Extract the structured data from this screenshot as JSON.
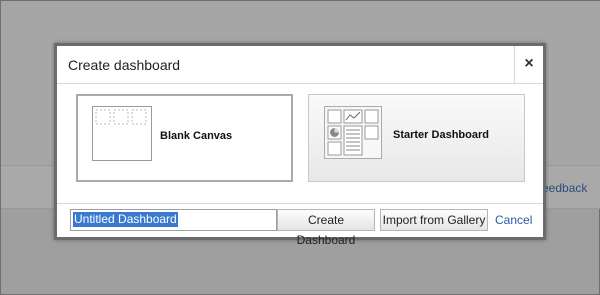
{
  "background": {
    "feedback_label": "eedback"
  },
  "dialog": {
    "title": "Create dashboard",
    "close_label": "×",
    "options": [
      {
        "label": "Blank Canvas"
      },
      {
        "label": "Starter Dashboard"
      }
    ],
    "name_input": {
      "value": "Untitled Dashboard"
    },
    "create_button_label": "Create Dashboard",
    "import_button_label": "Import from Gallery",
    "cancel_label": "Cancel"
  },
  "colors": {
    "overlay": "#a6a6a6",
    "selection": "#3a79d0",
    "link": "#2a5aa0"
  }
}
